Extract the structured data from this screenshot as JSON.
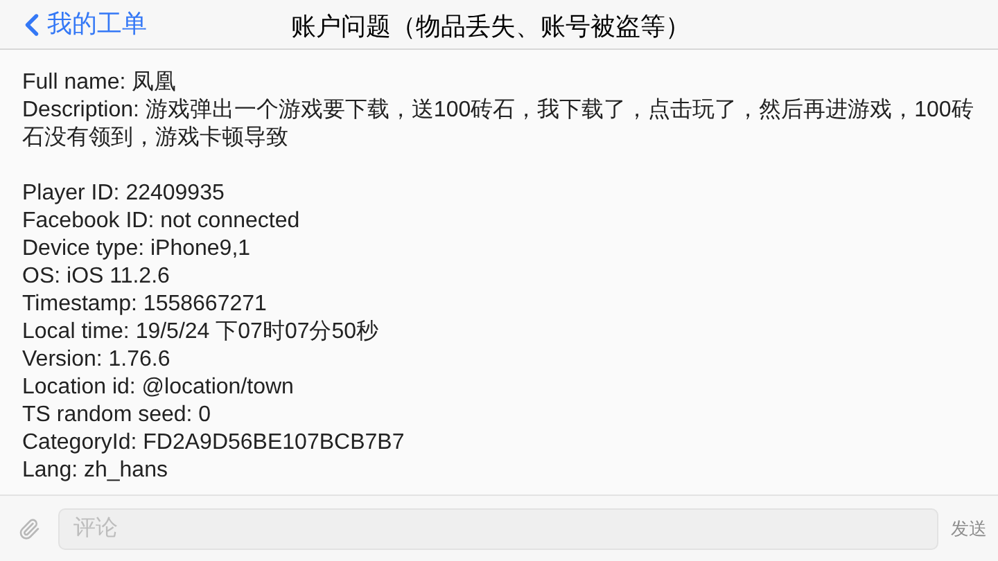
{
  "nav": {
    "back_label": "我的工单",
    "title": "账户问题（物品丢失、账号被盗等）"
  },
  "sections": [
    {
      "lines": [
        "Full name: 凤凰",
        "Description: 游戏弹出一个游戏要下载，送100砖石，我下载了，点击玩了，然后再进游戏，100砖石没有领到，游戏卡顿导致"
      ]
    },
    {
      "lines": [
        "Player ID: 22409935",
        "Facebook ID: not connected",
        "Device type: iPhone9,1",
        "OS: iOS 11.2.6",
        "Timestamp: 1558667271",
        "Local time: 19/5/24 下07时07分50秒",
        "Version: 1.76.6",
        "Location id: @location/town",
        "TS random seed: 0",
        "CategoryId: FD2A9D56BE107BCB7B7",
        "Lang: zh_hans"
      ]
    }
  ],
  "composer": {
    "placeholder": "评论",
    "send_label": "发送",
    "send_disabled": true
  }
}
